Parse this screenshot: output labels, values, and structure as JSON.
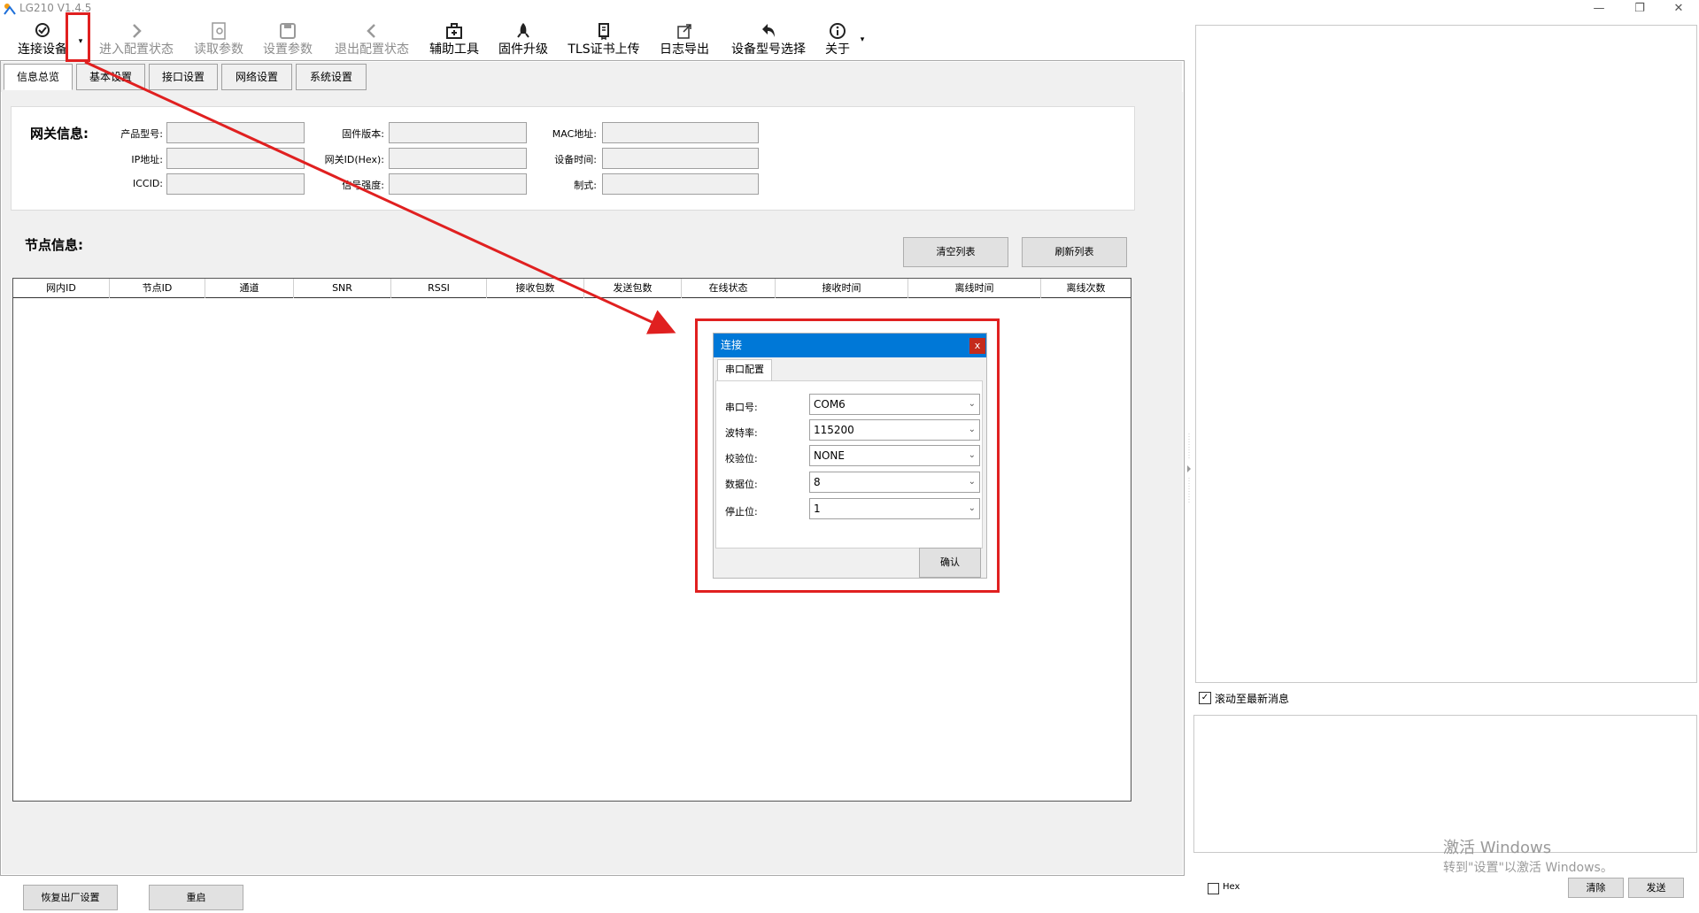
{
  "window": {
    "title": "LG210 V1.4.5",
    "minimize": "—",
    "restore": "❐",
    "close": "✕"
  },
  "toolbar": {
    "connect": "连接设备",
    "connect_dropdown": "▾",
    "enter_config": "进入配置状态",
    "read_params": "读取参数",
    "set_params": "设置参数",
    "exit_config": "退出配置状态",
    "aux_tools": "辅助工具",
    "firmware_upgrade": "固件升级",
    "tls_upload": "TLS证书上传",
    "log_export": "日志导出",
    "model_select": "设备型号选择",
    "about": "关于",
    "about_dropdown": "▾"
  },
  "tabs": [
    "信息总览",
    "基本设置",
    "接口设置",
    "网络设置",
    "系统设置"
  ],
  "gateway": {
    "title": "网关信息:",
    "labels": {
      "product_model": "产品型号:",
      "ip": "IP地址:",
      "iccid": "ICCID:",
      "firmware": "固件版本:",
      "gateway_id": "网关ID(Hex):",
      "signal": "信号强度:",
      "mac": "MAC地址:",
      "device_time": "设备时间:",
      "standard": "制式:"
    },
    "values": {
      "product_model": "",
      "ip": "",
      "iccid": "",
      "firmware": "",
      "gateway_id": "",
      "signal": "",
      "mac": "",
      "device_time": "",
      "standard": ""
    }
  },
  "nodes": {
    "title": "节点信息:",
    "clear_button": "清空列表",
    "refresh_button": "刷新列表",
    "columns": [
      "网内ID",
      "节点ID",
      "通道",
      "SNR",
      "RSSI",
      "接收包数",
      "发送包数",
      "在线状态",
      "接收时间",
      "离线时间",
      "离线次数"
    ],
    "rows": []
  },
  "bottom": {
    "factory_reset": "恢复出厂设置",
    "reboot": "重启"
  },
  "right_panel": {
    "scroll_latest_label": "滚动至最新消息",
    "scroll_latest_checked": true,
    "hex_label": "Hex",
    "hex_checked": false,
    "clear_button": "清除",
    "send_button": "发送"
  },
  "dialog": {
    "title": "连接",
    "close": "x",
    "tab": "串口配置",
    "fields": {
      "port_label": "串口号:",
      "port_value": "COM6",
      "baud_label": "波特率:",
      "baud_value": "115200",
      "parity_label": "校验位:",
      "parity_value": "NONE",
      "databits_label": "数据位:",
      "databits_value": "8",
      "stopbits_label": "停止位:",
      "stopbits_value": "1"
    },
    "confirm": "确认"
  },
  "watermark": {
    "line1": "激活 Windows",
    "line2": "转到\"设置\"以激活 Windows。"
  },
  "colors": {
    "annotation_red": "#e02020",
    "dialog_title_blue": "#0078d7"
  }
}
